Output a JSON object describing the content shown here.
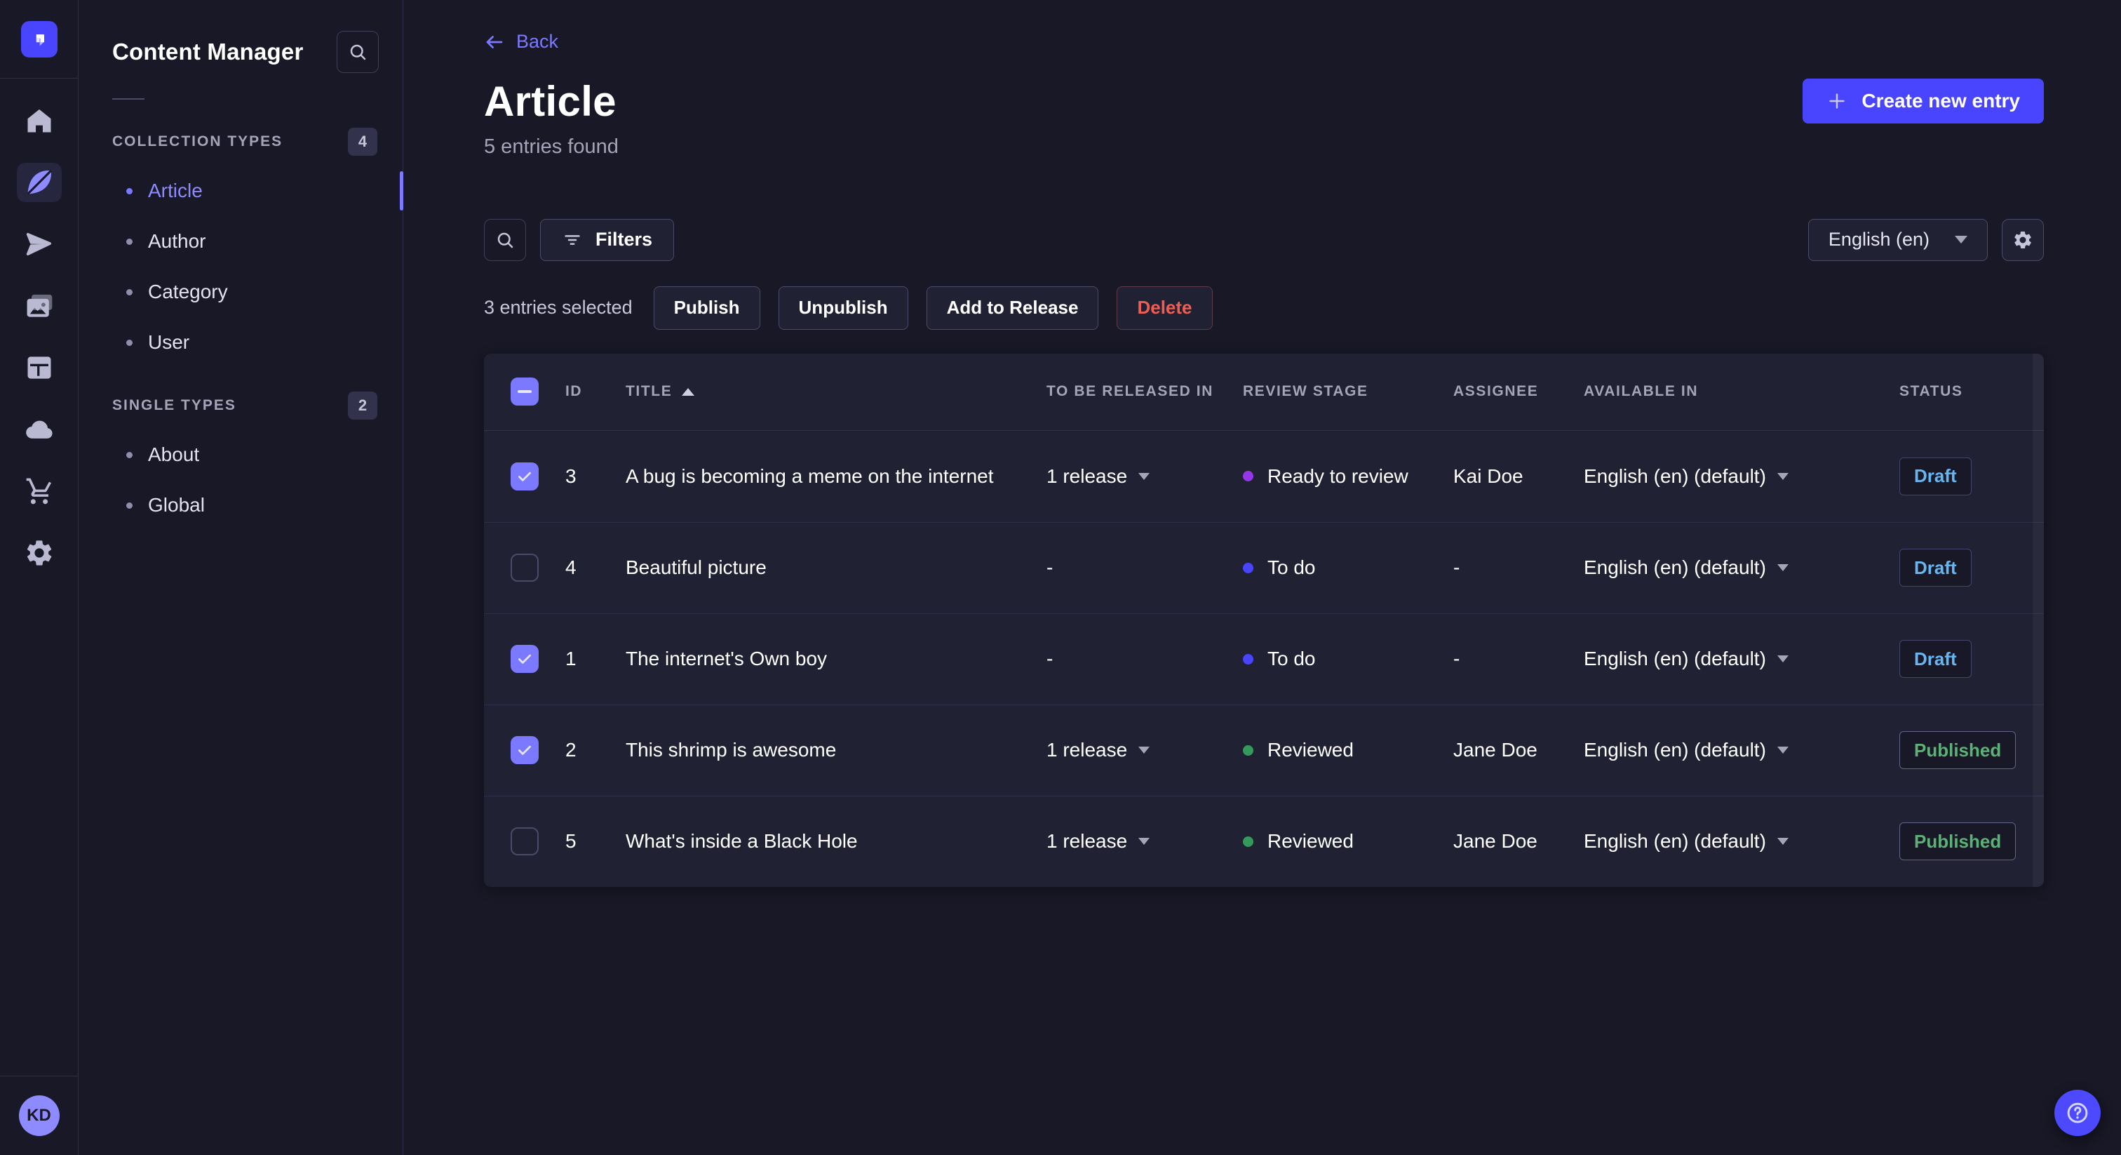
{
  "nav_rail": {
    "icons": [
      "home",
      "content-manager",
      "releases",
      "media-library",
      "content-type-builder",
      "deploy",
      "marketplace",
      "settings"
    ],
    "active_icon": "content-manager"
  },
  "user": {
    "initials": "KD"
  },
  "subnav": {
    "title": "Content Manager",
    "sections": [
      {
        "label": "Collection Types",
        "count": "4",
        "items": [
          {
            "label": "Article",
            "active": true
          },
          {
            "label": "Author"
          },
          {
            "label": "Category"
          },
          {
            "label": "User"
          }
        ]
      },
      {
        "label": "Single Types",
        "count": "2",
        "items": [
          {
            "label": "About"
          },
          {
            "label": "Global"
          }
        ]
      }
    ]
  },
  "header": {
    "back_label": "Back",
    "title": "Article",
    "subtitle": "5 entries found",
    "create_button": "Create new entry"
  },
  "toolbar": {
    "filters_label": "Filters",
    "locale_value": "English (en)"
  },
  "bulk_bar": {
    "selected_text": "3 entries selected",
    "publish": "Publish",
    "unpublish": "Unpublish",
    "add_to_release": "Add to Release",
    "delete": "Delete"
  },
  "table": {
    "columns": [
      "ID",
      "Title",
      "To be released in",
      "Review stage",
      "Assignee",
      "Available in",
      "Status"
    ],
    "sort_column": "Title",
    "sort_direction": "ascending",
    "rows": [
      {
        "checked": true,
        "id": "3",
        "title": "A bug is becoming a meme on the internet",
        "to_be_released_in": "1 release",
        "review_stage": "Ready to review",
        "stage_color": "#9736e8",
        "assignee": "Kai Doe",
        "available_in": "English (en) (default)",
        "status": "Draft"
      },
      {
        "checked": false,
        "id": "4",
        "title": "Beautiful picture",
        "to_be_released_in": "-",
        "review_stage": "To do",
        "stage_color": "#4945ff",
        "assignee": "-",
        "available_in": "English (en) (default)",
        "status": "Draft"
      },
      {
        "checked": true,
        "id": "1",
        "title": "The internet's Own boy",
        "to_be_released_in": "-",
        "review_stage": "To do",
        "stage_color": "#4945ff",
        "assignee": "-",
        "available_in": "English (en) (default)",
        "status": "Draft"
      },
      {
        "checked": true,
        "id": "2",
        "title": "This shrimp is awesome",
        "to_be_released_in": "1 release",
        "review_stage": "Reviewed",
        "stage_color": "#35995c",
        "assignee": "Jane Doe",
        "available_in": "English (en) (default)",
        "status": "Published"
      },
      {
        "checked": false,
        "id": "5",
        "title": "What's inside a Black Hole",
        "to_be_released_in": "1 release",
        "review_stage": "Reviewed",
        "stage_color": "#35995c",
        "assignee": "Jane Doe",
        "available_in": "English (en) (default)",
        "status": "Published"
      }
    ]
  },
  "colors": {
    "primary": "#4945ff",
    "primary_light": "#7b79ff",
    "draft_badge": "#66b7f1",
    "published_badge": "#5cb176",
    "danger": "#ee5e52",
    "stage_ready_to_review": "#9736e8",
    "stage_to_do": "#4945ff",
    "stage_reviewed": "#35995c"
  }
}
